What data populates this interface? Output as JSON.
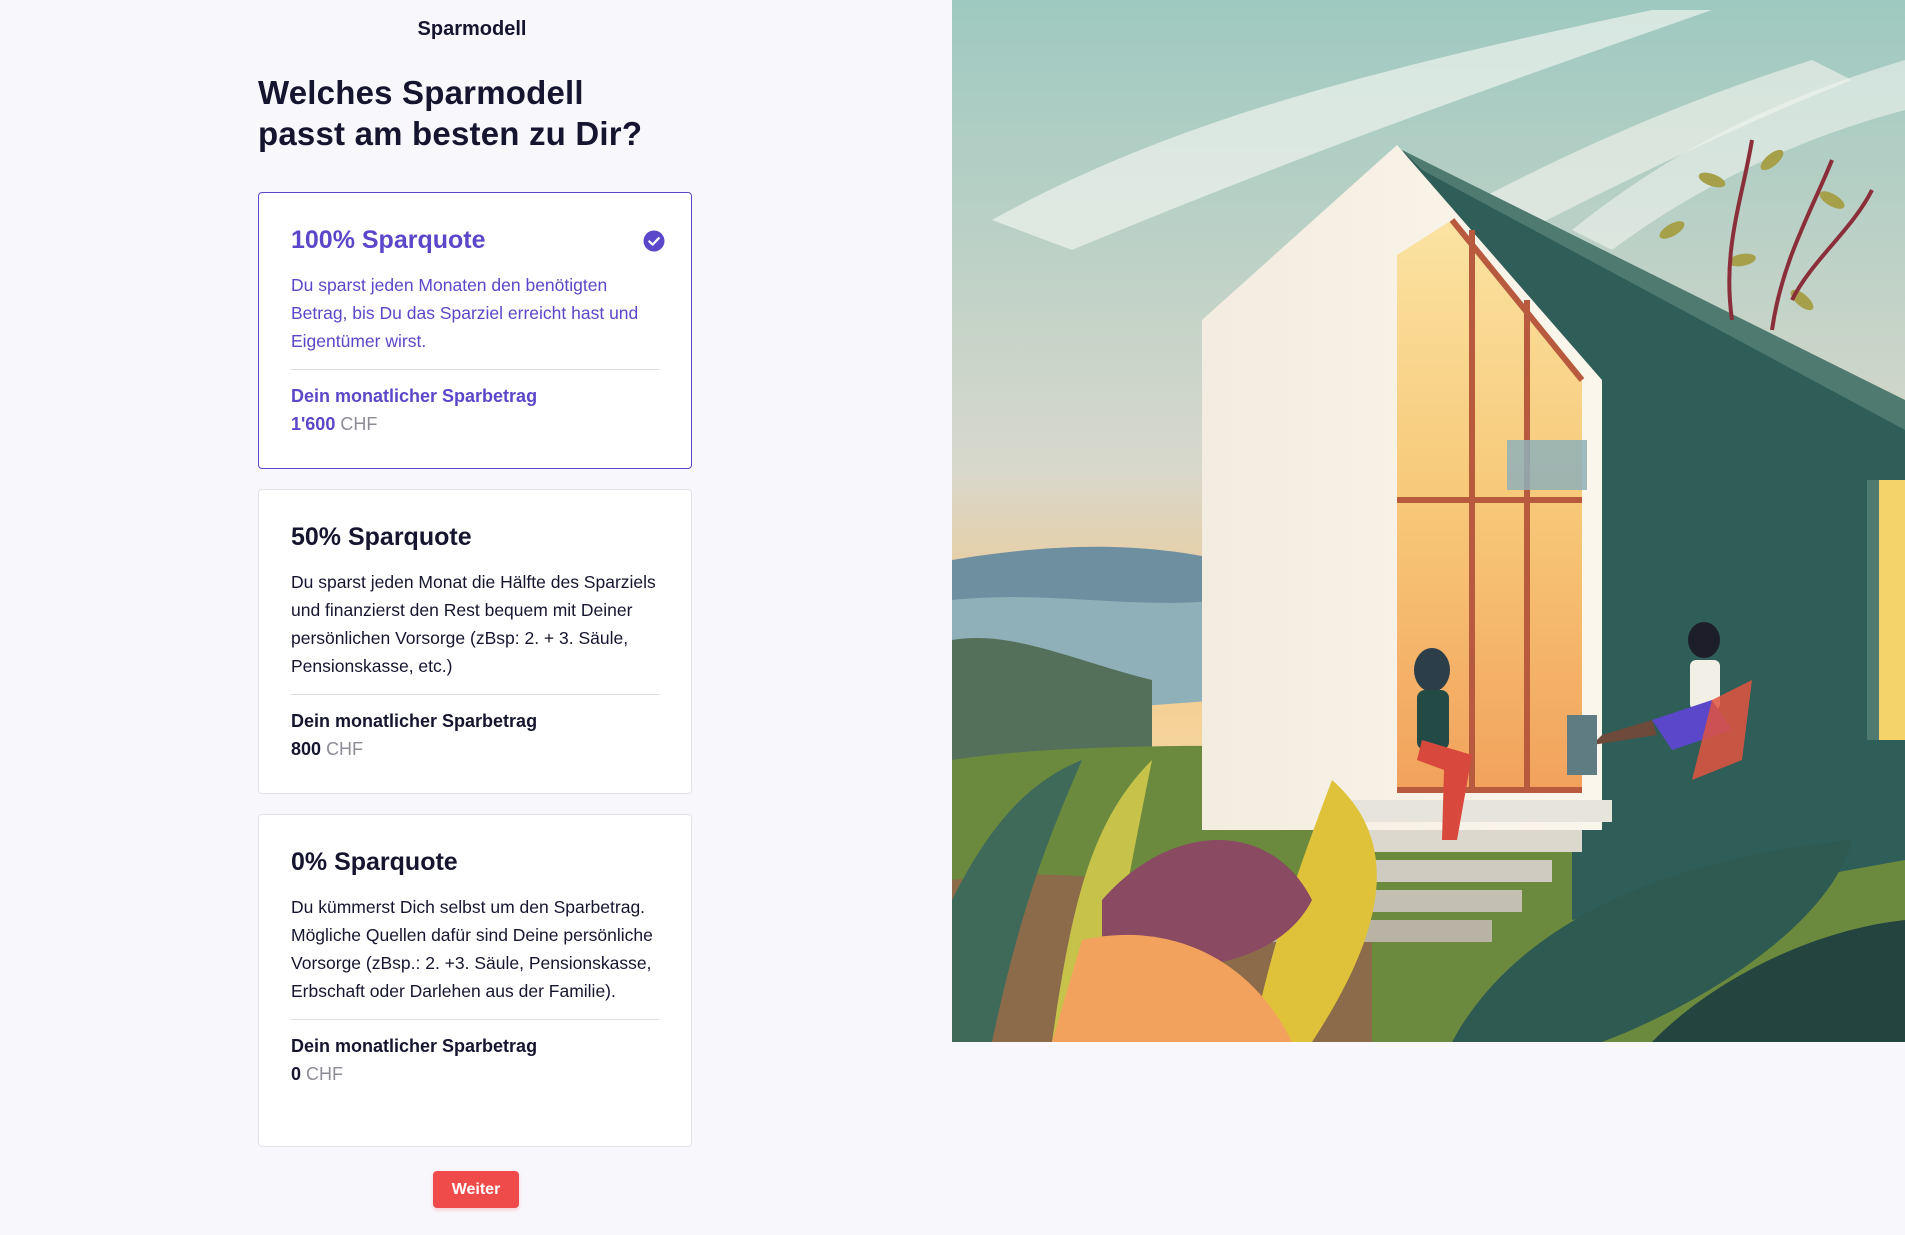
{
  "header": {
    "step_label": "Sparmodell"
  },
  "main": {
    "headline": "Welches Sparmodell passt am besten zu Dir?",
    "options": [
      {
        "title": "100% Sparquote",
        "description": "Du sparst jeden Monaten den benötigten Betrag, bis Du das Sparziel erreicht hast und Eigentümer wirst.",
        "amount_label": "Dein monatlicher Sparbetrag",
        "amount_value": "1'600",
        "amount_currency": "CHF",
        "selected": true
      },
      {
        "title": "50% Sparquote",
        "description": "Du sparst jeden Monat die Hälfte des Sparziels und finanzierst den Rest bequem mit Deiner persönlichen Vorsorge (zBsp: 2. + 3. Säule, Pensionskasse, etc.)",
        "amount_label": "Dein monatlicher Sparbetrag",
        "amount_value": "800",
        "amount_currency": "CHF",
        "selected": false
      },
      {
        "title": "0% Sparquote",
        "description": "Du kümmerst Dich selbst um den Sparbetrag. Mögliche Quellen dafür sind Deine persönliche Vorsorge (zBsp.: 2. +3. Säule, Pensionskasse, Erbschaft oder Darlehen aus der Familie).",
        "amount_label": "Dein monatlicher Sparbetrag",
        "amount_value": "0",
        "amount_currency": "CHF",
        "selected": false
      }
    ],
    "next_label": "Weiter"
  },
  "icons": {
    "selected_check": "check-circle-icon"
  },
  "colors": {
    "accent": "#5b47c9",
    "button": "#f04b4b",
    "text": "#151530",
    "muted": "#8c8c96",
    "background": "#f8f8fc"
  }
}
